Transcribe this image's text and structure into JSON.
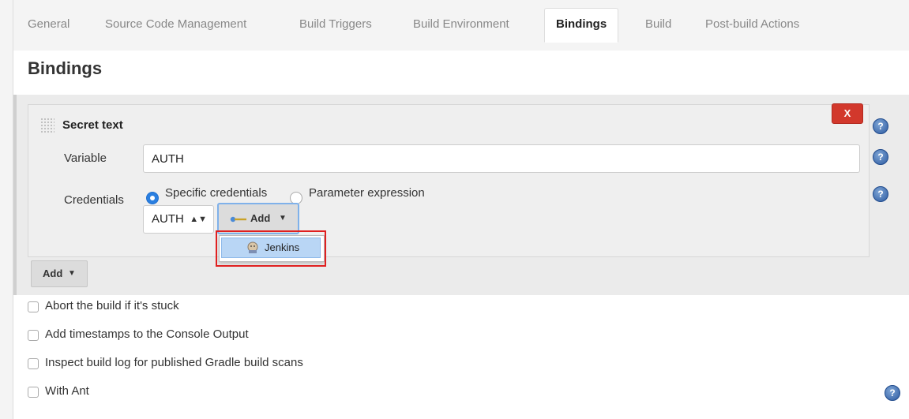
{
  "tabs": [
    {
      "label": "General"
    },
    {
      "label": "Source Code Management"
    },
    {
      "label": "Build Triggers"
    },
    {
      "label": "Build Environment"
    },
    {
      "label": "Bindings"
    },
    {
      "label": "Build"
    },
    {
      "label": "Post-build Actions"
    }
  ],
  "active_tab": "Bindings",
  "section": {
    "title": "Bindings"
  },
  "binding": {
    "title": "Secret text",
    "delete_label": "X",
    "variable_label": "Variable",
    "variable_value": "AUTH",
    "credentials_label": "Credentials",
    "radio_specific": "Specific credentials",
    "radio_parameter": "Parameter expression",
    "selected_credential": "AUTH",
    "add_cred_label": "Add",
    "dropdown_item": "Jenkins"
  },
  "add_button_label": "Add",
  "options": [
    {
      "label": "Abort the build if it's stuck"
    },
    {
      "label": "Add timestamps to the Console Output"
    },
    {
      "label": "Inspect build log for published Gradle build scans"
    },
    {
      "label": "With Ant"
    }
  ],
  "colors": {
    "accent_blue": "#2a7fe0",
    "delete_red": "#d2382c",
    "highlight_red": "#e02020",
    "dropdown_selected": "#b9d6f5"
  },
  "icons": [
    "help-icon",
    "key-icon",
    "chevron-down-icon",
    "jenkins-icon",
    "drag-handle-icon",
    "select-arrows-icon"
  ]
}
